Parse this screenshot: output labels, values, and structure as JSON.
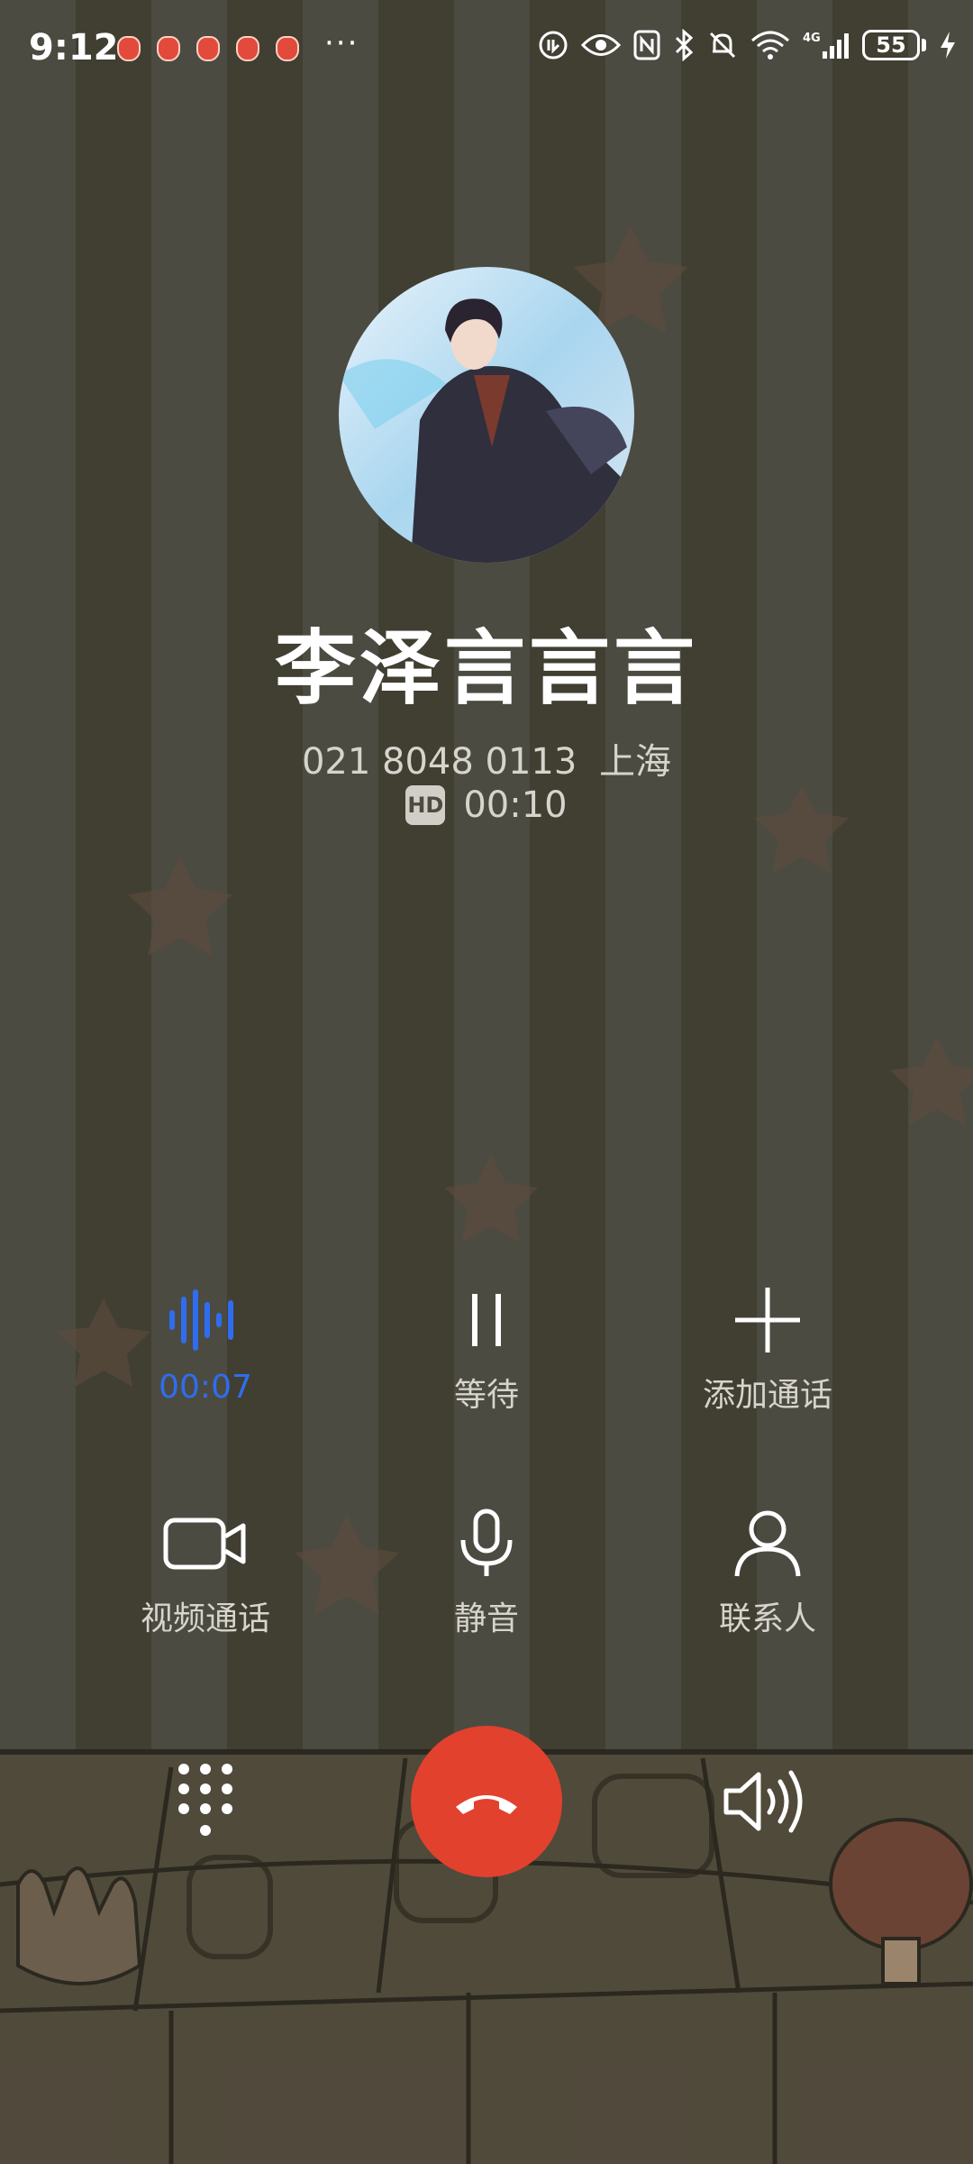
{
  "status_bar": {
    "time": "9:12",
    "more": "···",
    "battery": "55",
    "icons": [
      "strawberry-notification-icon",
      "eye-icon",
      "nfc-icon",
      "bluetooth-icon",
      "mute-bell-icon",
      "wifi-icon",
      "4g-signal-icon",
      "battery-icon",
      "charging-icon"
    ]
  },
  "caller": {
    "name": "李泽言言言",
    "number": "021 8048 0113",
    "location": "上海",
    "hd_badge": "HD",
    "duration": "00:10"
  },
  "controls": {
    "record": {
      "label": "00:07",
      "icon": "voice-recording-icon",
      "active_color": "#2f6df0"
    },
    "hold": {
      "label": "等待",
      "icon": "pause-icon"
    },
    "add_call": {
      "label": "添加通话",
      "icon": "plus-icon"
    },
    "video_call": {
      "label": "视频通话",
      "icon": "video-camera-icon"
    },
    "mute": {
      "label": "静音",
      "icon": "microphone-icon"
    },
    "contacts": {
      "label": "联系人",
      "icon": "person-icon"
    }
  },
  "bottom": {
    "dialpad_icon": "dialpad-icon",
    "end_call_icon": "hang-up-icon",
    "end_call_color": "#e2412e",
    "speaker_icon": "speaker-icon"
  }
}
